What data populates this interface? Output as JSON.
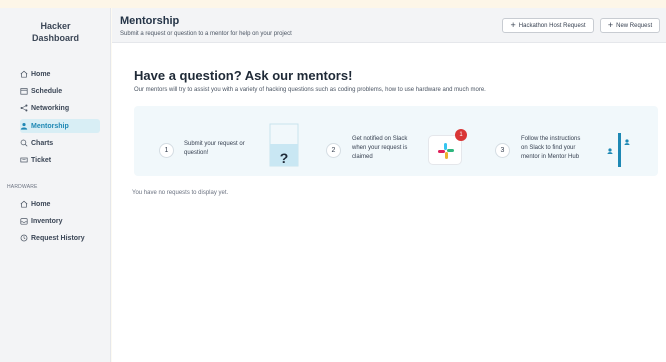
{
  "app": {
    "brand_line1": "Hacker",
    "brand_line2": "Dashboard"
  },
  "sidebar": {
    "items": [
      {
        "label": "Home",
        "icon": "home-icon"
      },
      {
        "label": "Schedule",
        "icon": "calendar-icon"
      },
      {
        "label": "Networking",
        "icon": "share-icon"
      },
      {
        "label": "Mentorship",
        "icon": "mentor-icon",
        "active": true
      },
      {
        "label": "Charts",
        "icon": "search-icon"
      },
      {
        "label": "Ticket",
        "icon": "ticket-icon"
      }
    ],
    "hardware_section": "HARDWARE",
    "hardware_items": [
      {
        "label": "Home",
        "icon": "home-icon"
      },
      {
        "label": "Inventory",
        "icon": "inbox-icon"
      },
      {
        "label": "Request History",
        "icon": "clock-icon"
      }
    ]
  },
  "header": {
    "title": "Mentorship",
    "subtitle": "Submit a request or question to a mentor for help on your project",
    "host_button": "Hackathon Host Request",
    "new_button": "New Request"
  },
  "main": {
    "heading": "Have a question? Ask our mentors!",
    "description": "Our mentors will try to assist you with a variety of hacking questions such as coding problems, how to use hardware and much more.",
    "steps": [
      {
        "number": "1",
        "text_line1": "Submit your request or",
        "text_line2": "question!"
      },
      {
        "number": "2",
        "text_line1": "Get notified on Slack",
        "text_line2": "when your request is",
        "text_line3": "claimed",
        "badge": "1"
      },
      {
        "number": "3",
        "text_line1": "Follow the instructions",
        "text_line2": "on Slack to find your",
        "text_line3": "mentor in Mentor Hub"
      }
    ],
    "question_mark": "?",
    "empty_message": "You have no requests to display yet."
  },
  "colors": {
    "accent": "#1e88b4",
    "active_bg": "#d8eef5",
    "steps_bg": "#f1f8fb",
    "badge": "#d93636"
  }
}
